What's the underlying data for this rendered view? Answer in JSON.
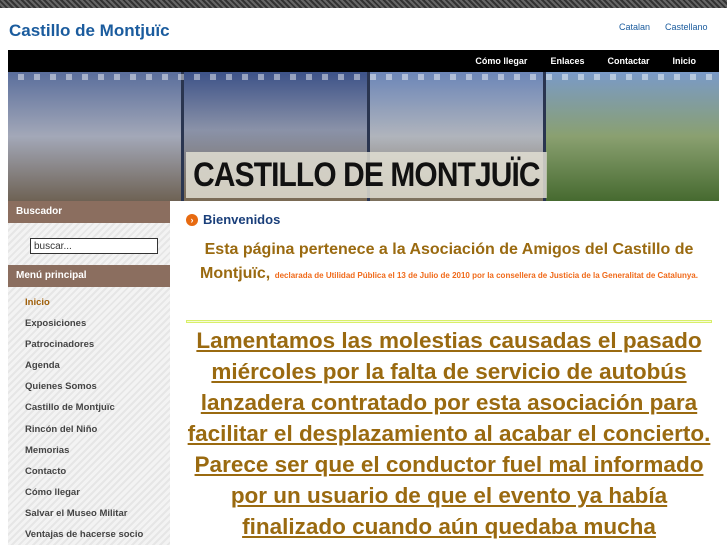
{
  "header": {
    "site_title": "Castillo de Montjuïc",
    "languages": [
      "Catalan",
      "Castellano"
    ]
  },
  "nav": [
    "Cómo llegar",
    "Enlaces",
    "Contactar",
    "Inicio"
  ],
  "banner": {
    "title": "CASTILLO DE MONTJUÏC"
  },
  "sidebar": {
    "search_title": "Buscador",
    "search_value": "buscar...",
    "menu_title": "Menú principal",
    "menu": [
      "Inicio",
      "Exposiciones",
      "Patrocinadores",
      "Agenda",
      "Quienes Somos",
      "Castillo de Montjuïc",
      "Rincón del Niño",
      "Memorias",
      "Contacto",
      "Cómo llegar",
      "Salvar el Museo Militar",
      "Ventajas de hacerse socio"
    ]
  },
  "main": {
    "heading": "Bienvenidos",
    "intro_large": "Esta página pertenece a la Asociación de Amigos del Castillo de Montjuïc,",
    "intro_small": "declarada de Utilidad Pública el 13 de Julio de 2010 por la consellera de Justicia de la Generalitat de Catalunya.",
    "notice": "Lamentamos las molestias causadas el pasado miércoles por la falta de servicio de autobús lanzadera contratado por esta asociación para facilitar el desplazamiento al acabar el concierto. Parece ser que el conductor fuel mal informado por un usuario de que el evento ya había finalizado cuando aún quedaba mucha"
  }
}
